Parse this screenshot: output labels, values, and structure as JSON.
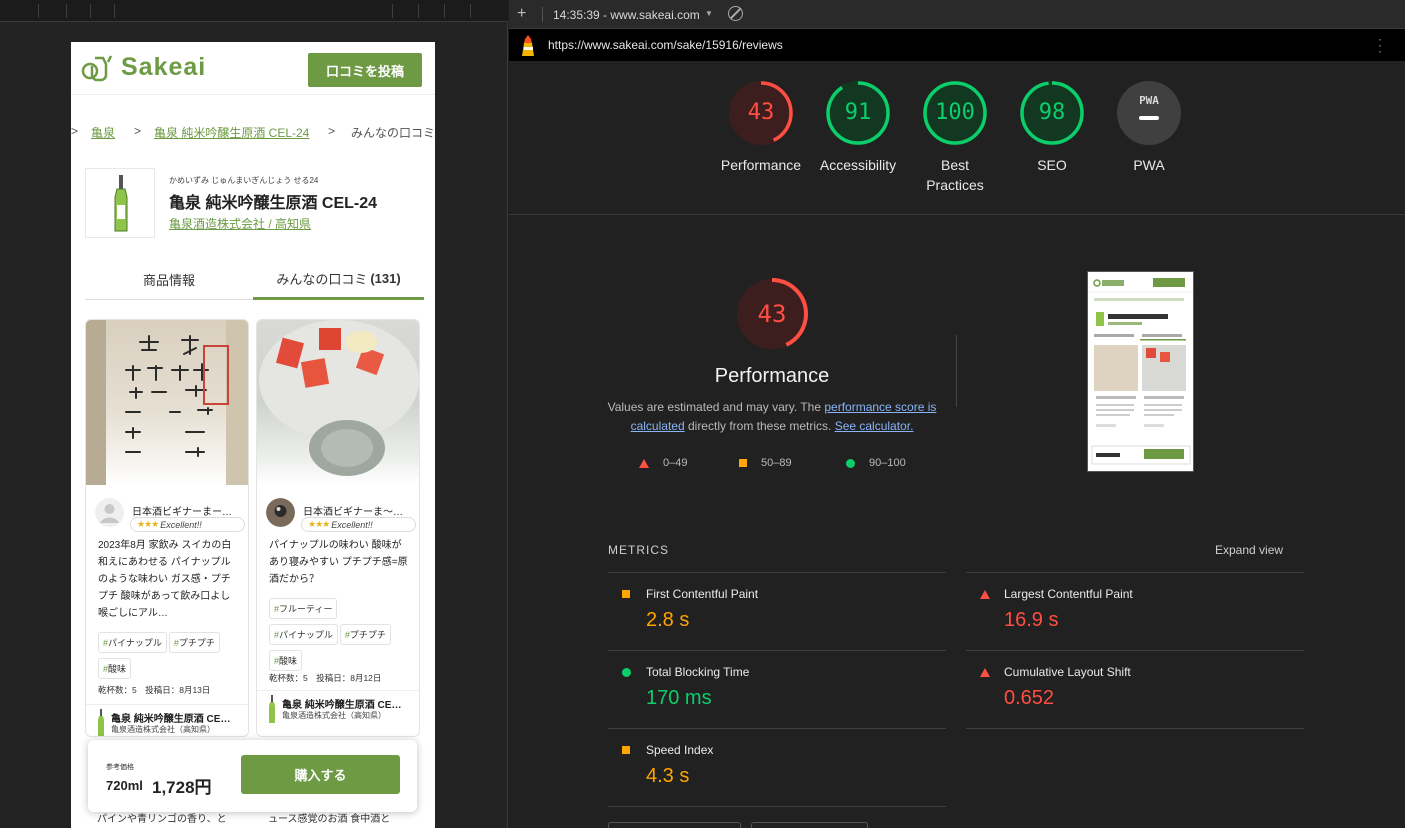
{
  "left": {
    "header": {
      "logo_text": "Sakeai",
      "post_button": "口コミを投稿"
    },
    "breadcrumb": {
      "sep1": ">",
      "item1": "亀泉",
      "sep2": ">",
      "item2": "亀泉 純米吟醸生原酒 CEL-24",
      "sep3": ">",
      "current": "みんなの口コミ"
    },
    "product": {
      "reading": "かめいずみ じゅんまいぎんじょう せる24",
      "title": "亀泉 純米吟醸生原酒 CEL-24",
      "brewery": "亀泉酒造株式会社 / 高知県"
    },
    "tabs": {
      "info": "商品情報",
      "reviews_label": "みんなの口コミ",
      "reviews_count": "(131)"
    },
    "cards": [
      {
        "reviewer": "日本酒ビギナーまー…",
        "rating_stars": "★★★",
        "rating_text": "Excellent!!",
        "body": "2023年8月 家飲み スイカの白和えにあわせる パイナップルのような味わい ガス感・プチプチ 酸味があって飲み口よし 喉ごしにアル…",
        "tags": [
          "パイナップル",
          "プチプチ",
          "酸味"
        ],
        "meta": "乾杯数：5　投稿日：8月13日",
        "foot_name": "亀泉 純米吟醸生原酒 CE…",
        "foot_brewery": "亀泉酒造株式会社（高知県）",
        "under_text": "パインや青リンゴの香り、と"
      },
      {
        "reviewer": "日本酒ビギナーま〜…",
        "rating_stars": "★★★",
        "rating_text": "Excellent!!",
        "body": "パイナップルの味わい 酸味があり寝みやすい プチプチ感=原酒だから？",
        "tags": [
          "フルーティー",
          "パイナップル",
          "プチプチ",
          "酸味"
        ],
        "meta": "乾杯数：5　投稿日：8月12日",
        "foot_name": "亀泉 純米吟醸生原酒 CE…",
        "foot_brewery": "亀泉酒造株式会社（高知県）",
        "under_text": "ュース感覚のお酒 食中酒と"
      }
    ],
    "buybar": {
      "ref_label": "参考価格",
      "volume": "720ml",
      "price": "1,728円",
      "buy_button": "購入する"
    }
  },
  "right": {
    "tabbar": {
      "plus": "+",
      "session": "14:35:39 - www.sakeai.com",
      "caret": "▼"
    },
    "url": "https://www.sakeai.com/sake/15916/reviews",
    "gauges": [
      {
        "score": "43",
        "label": "Performance",
        "value": 43,
        "color": "#ff4e42",
        "track": "#3d1e1e"
      },
      {
        "score": "91",
        "label": "Accessibility",
        "value": 91,
        "color": "#0cce6b",
        "track": "#123822"
      },
      {
        "score": "100",
        "label": "Best Practices",
        "value": 100,
        "color": "#0cce6b",
        "track": "#123822"
      },
      {
        "score": "98",
        "label": "SEO",
        "value": 98,
        "color": "#0cce6b",
        "track": "#123822"
      },
      {
        "score": "PWA",
        "label": "PWA",
        "value": 0,
        "color": "#9e9e9e",
        "track": "#404040"
      }
    ],
    "perf": {
      "score": "43",
      "value": 43,
      "title": "Performance",
      "note_pre": "Values are estimated and may vary. The ",
      "note_link1": "performance score is calculated",
      "note_mid": " directly from these metrics. ",
      "note_link2": "See calculator.",
      "legend": [
        {
          "range": "0–49",
          "shape": "triangle",
          "color": "#ff4e42"
        },
        {
          "range": "50–89",
          "shape": "square",
          "color": "#ffa400"
        },
        {
          "range": "90–100",
          "shape": "circle",
          "color": "#0cce6b"
        }
      ]
    },
    "metrics": {
      "header": "METRICS",
      "expand": "Expand view",
      "items": [
        {
          "name": "First Contentful Paint",
          "value": "2.8 s",
          "status": "average",
          "color": "#ffa400"
        },
        {
          "name": "Largest Contentful Paint",
          "value": "16.9 s",
          "status": "fail",
          "color": "#ff4e42"
        },
        {
          "name": "Total Blocking Time",
          "value": "170 ms",
          "status": "pass",
          "color": "#0cce6b"
        },
        {
          "name": "Cumulative Layout Shift",
          "value": "0.652",
          "status": "fail",
          "color": "#ff4e42"
        },
        {
          "name": "Speed Index",
          "value": "4.3 s",
          "status": "average",
          "color": "#ffa400"
        }
      ]
    }
  }
}
